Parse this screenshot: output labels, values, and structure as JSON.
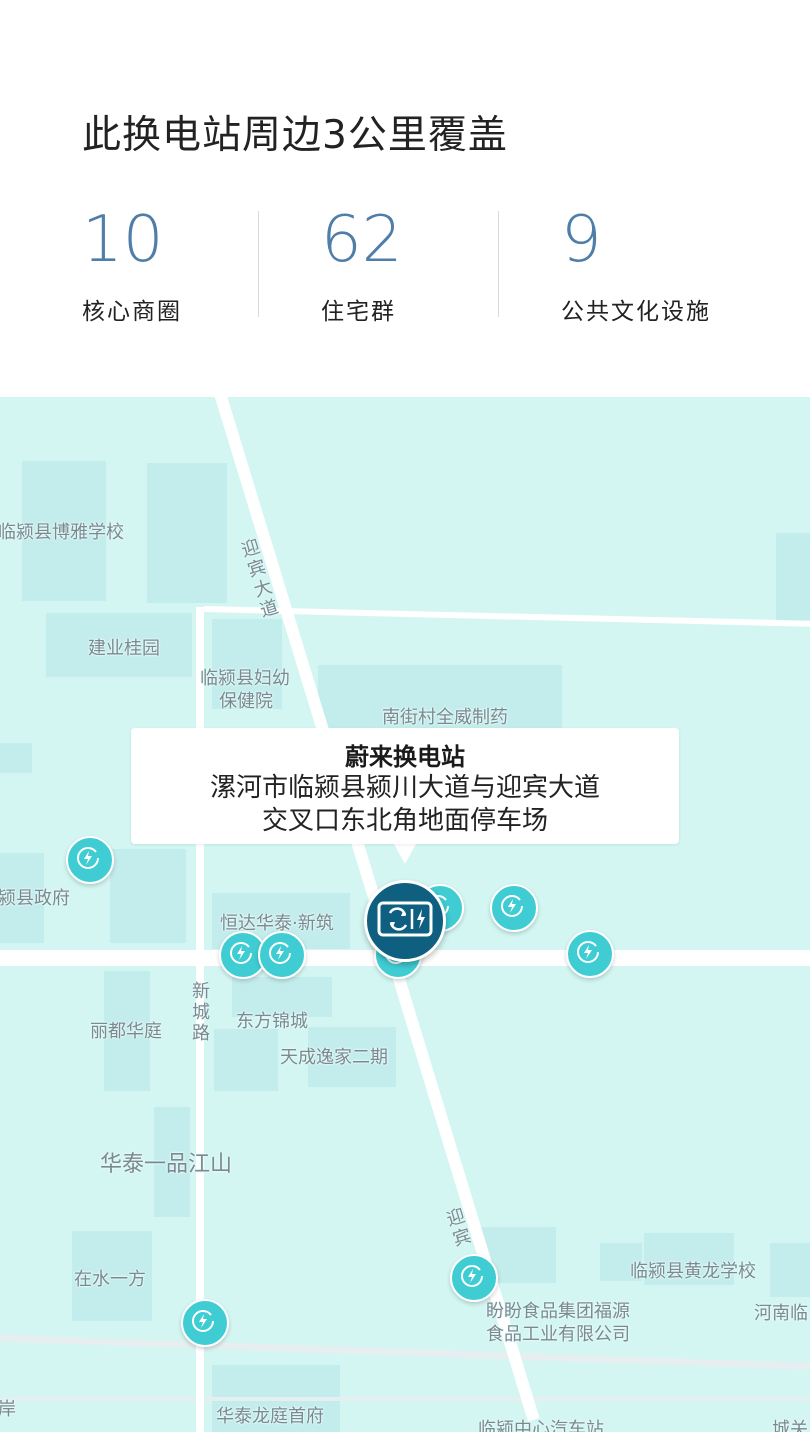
{
  "header": {
    "title": "此换电站周边3公里覆盖"
  },
  "stats": [
    {
      "value": "10",
      "label": "核心商圈"
    },
    {
      "value": "62",
      "label": "住宅群"
    },
    {
      "value": "9",
      "label": "公共文化设施"
    }
  ],
  "callout": {
    "title": "蔚来换电站",
    "address_line1": "漯河市临颍县颍川大道与迎宾大道",
    "address_line2": "交叉口东北角地面停车场"
  },
  "map": {
    "labels": {
      "boya_school": "临颍县博雅学校",
      "yingbin_road_north": "迎宾大道",
      "jianye_guiyuan": "建业桂园",
      "maternal_hospital_1": "临颍县妇幼",
      "maternal_hospital_2": "保健院",
      "nanjiecun_pharma": "南街村全威制药",
      "county_gov": "颍县政府",
      "hengda_huatai": "恒达华泰·新筑",
      "xincheng_road": "新城路",
      "lidu_huating": "丽都华庭",
      "dongfang_jincheng": "东方锦城",
      "tiancheng_yijia": "天成逸家二期",
      "huatai_yipin": "华泰一品江山",
      "yingbin_road_south": "迎宾",
      "huanglong_school": "临颍县黄龙学校",
      "zaishui_yifang": "在水一方",
      "panpan_food_1": "盼盼食品集团福源",
      "panpan_food_2": "食品工业有限公司",
      "henan_lin": "河南临",
      "huatai_longting": "华泰龙庭首府",
      "bus_station": "临颍中心汽车站",
      "edge_left": "岸",
      "edge_right": "城关"
    }
  },
  "colors": {
    "stat_value": "#4f7ea8",
    "map_background": "#d3f6f3",
    "pin_small": "#3fccd2",
    "pin_main": "#0e5f80"
  },
  "icons": {
    "small_pin": "charging-bolt-icon",
    "main_pin": "battery-swap-icon"
  }
}
